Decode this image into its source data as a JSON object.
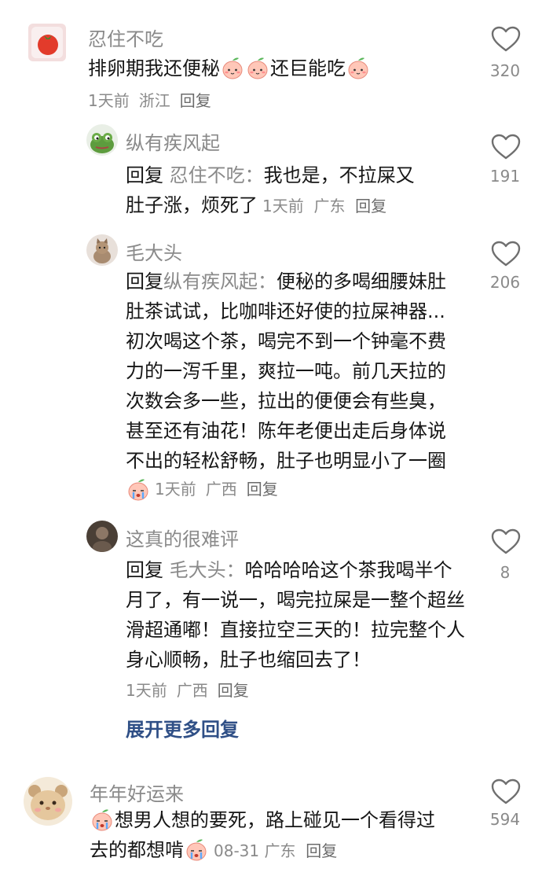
{
  "comments": [
    {
      "name": "忍住不吃",
      "lines": [
        "排卵期我还便秘",
        "还巨能吃"
      ],
      "time": "1天前",
      "location": "浙江",
      "reply": "回复",
      "likes": "320"
    },
    {
      "name": "纵有疾风起",
      "reply_prefix": "回复",
      "reply_target": "忍住不吃：",
      "lines": [
        "我也是，不拉屎又",
        "肚子涨，烦死了"
      ],
      "time": "1天前",
      "location": "广东",
      "reply": "回复",
      "likes": "191"
    },
    {
      "name": "毛大头",
      "reply_prefix": "回复",
      "reply_target": "纵有疾风起：",
      "lines": [
        "便秘的多喝细腰妹肚",
        "肚茶试试，比咖啡还好使的拉屎神器...",
        "初次喝这个茶，喝完不到一个钟毫不费",
        "力的一泻千里，爽拉一吨。前几天拉的",
        "次数会多一些，拉出的便便会有些臭，",
        "甚至还有油花！陈年老便出走后身体说",
        "不出的轻松舒畅，肚子也明显小了一圈"
      ],
      "time": "1天前",
      "location": "广西",
      "reply": "回复",
      "likes": "206"
    },
    {
      "name": "这真的很难评",
      "reply_prefix": "回复",
      "reply_target": "毛大头：",
      "lines": [
        "哈哈哈哈这个茶我喝半个",
        "月了，有一说一，喝完拉屎是一整个超丝",
        "滑超通嘟！直接拉空三天的！拉完整个人",
        "身心顺畅，肚子也缩回去了！"
      ],
      "time": "1天前",
      "location": "广西",
      "reply": "回复",
      "likes": "8"
    },
    {
      "name": "年年好运来",
      "lines": [
        "想男人想的要死，路上碰见一个看得过",
        "去的都想啃"
      ],
      "time": "08-31",
      "location": "广东",
      "reply": "回复",
      "likes": "594"
    }
  ],
  "expand_label": "展开更多回复",
  "icons": {
    "like": "heart-outline-icon",
    "emoji_peach": "peach-face-emoji-icon",
    "emoji_cry": "crying-face-emoji-icon"
  },
  "colors": {
    "text": "#161616",
    "muted": "#8a8a8a",
    "link": "#2f4f86"
  }
}
